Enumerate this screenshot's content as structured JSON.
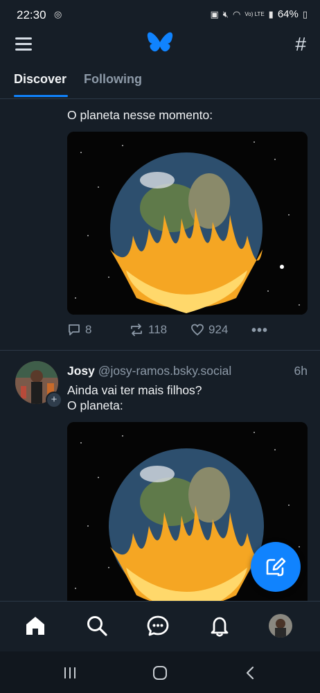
{
  "status_bar": {
    "time": "22:30",
    "battery": "64%",
    "signal_text": "Vo) LTE"
  },
  "header": {
    "logo_name": "bluesky-butterfly-logo"
  },
  "tabs": [
    {
      "label": "Discover",
      "active": true
    },
    {
      "label": "Following",
      "active": false
    }
  ],
  "posts": [
    {
      "text": "O planeta nesse momento:",
      "replies": "8",
      "reposts": "118",
      "likes": "924"
    },
    {
      "author": "Josy",
      "handle": "@josy-ramos.bsky.social",
      "time": "6h",
      "text_lines": [
        "Ainda vai ter mais filhos?",
        "O planeta:"
      ]
    }
  ],
  "colors": {
    "background": "#161e27",
    "accent": "#1083fe",
    "muted": "#8d9aa8"
  },
  "bottom_nav": [
    "home-icon",
    "search-icon",
    "chat-icon",
    "notifications-icon",
    "profile-avatar"
  ]
}
